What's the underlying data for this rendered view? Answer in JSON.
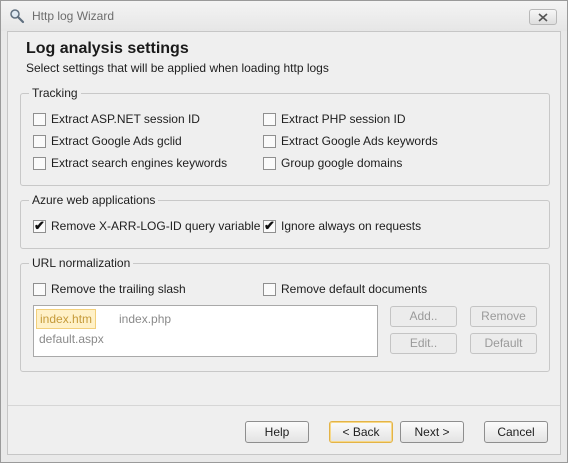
{
  "window": {
    "title": "Http log Wizard"
  },
  "header": {
    "title": "Log analysis settings",
    "subtitle": "Select settings that will be applied when loading http logs"
  },
  "tracking": {
    "legend": "Tracking",
    "items": [
      {
        "label": "Extract ASP.NET session ID",
        "checked": false
      },
      {
        "label": "Extract PHP session ID",
        "checked": false
      },
      {
        "label": "Extract Google Ads gclid",
        "checked": false
      },
      {
        "label": "Extract Google Ads keywords",
        "checked": false
      },
      {
        "label": "Extract search engines keywords",
        "checked": false
      },
      {
        "label": "Group google domains",
        "checked": false
      }
    ]
  },
  "azure": {
    "legend": "Azure web applications",
    "items": [
      {
        "label": "Remove X-ARR-LOG-ID query variable",
        "checked": true
      },
      {
        "label": "Ignore always on requests",
        "checked": true
      }
    ]
  },
  "url": {
    "legend": "URL normalization",
    "items": [
      {
        "label": "Remove the trailing slash",
        "checked": false
      },
      {
        "label": "Remove default documents",
        "checked": false
      }
    ],
    "documents": [
      "index.htm",
      "index.php",
      "default.aspx"
    ],
    "selected_document": "index.htm",
    "buttons": {
      "add": "Add..",
      "remove": "Remove",
      "edit": "Edit..",
      "default": "Default"
    }
  },
  "footer": {
    "help": "Help",
    "back": "< Back",
    "next": "Next >",
    "cancel": "Cancel"
  },
  "glyphs": {
    "check": "✔"
  }
}
